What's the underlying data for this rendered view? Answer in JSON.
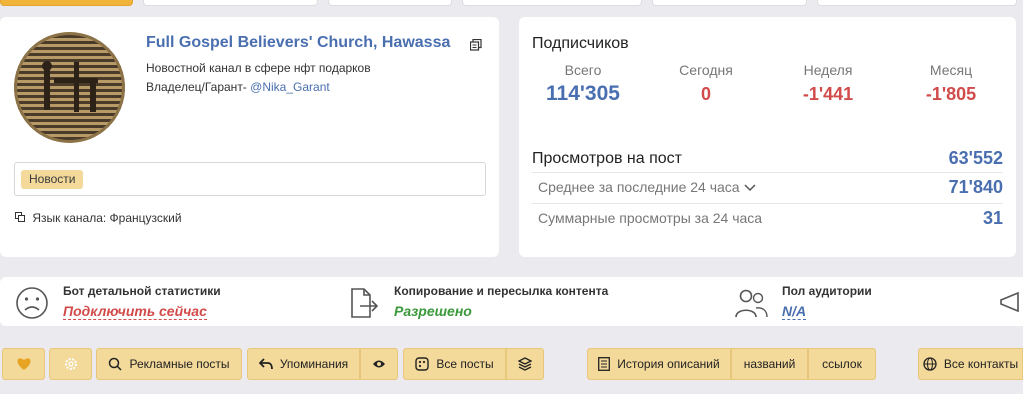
{
  "channel": {
    "title": "Full Gospel Believers' Church, Hawassa",
    "description": "Новостной канал в сфере нфт подарков",
    "owner_label": "Владелец/Гарант-",
    "owner_handle": "@Nika_Garant",
    "tag": "Новости",
    "language": "Язык канала: Французский"
  },
  "subscribers": {
    "title": "Подписчиков",
    "columns": [
      {
        "label": "Всего",
        "value": "114'305"
      },
      {
        "label": "Сегодня",
        "value": "0"
      },
      {
        "label": "Неделя",
        "value": "-1'441"
      },
      {
        "label": "Месяц",
        "value": "-1'805"
      }
    ]
  },
  "views": {
    "title": "Просмотров на пост",
    "value": "63'552",
    "rows": [
      {
        "label": "Среднее за последние 24 часа",
        "value": "71'840"
      },
      {
        "label": "Суммарные просмотры за 24 часа",
        "value": "31"
      }
    ]
  },
  "info": {
    "bot": {
      "title": "Бот детальной статистики",
      "value": "Подключить сейчас"
    },
    "copy": {
      "title": "Копирование и пересылка контента",
      "value": "Разрешено"
    },
    "gender": {
      "title": "Пол аудитории",
      "value": "N/A"
    }
  },
  "buttons": {
    "ads": "Рекламные посты",
    "mentions": "Упоминания",
    "all_posts": "Все посты",
    "history": "История описаний",
    "names": "названий",
    "links": "ссылок",
    "contacts": "Все контакты"
  },
  "colors": {
    "accent": "#4a6fb0",
    "negative": "#d24b4b",
    "positive": "#3a9a3a",
    "button_bg": "#f3d99a"
  }
}
